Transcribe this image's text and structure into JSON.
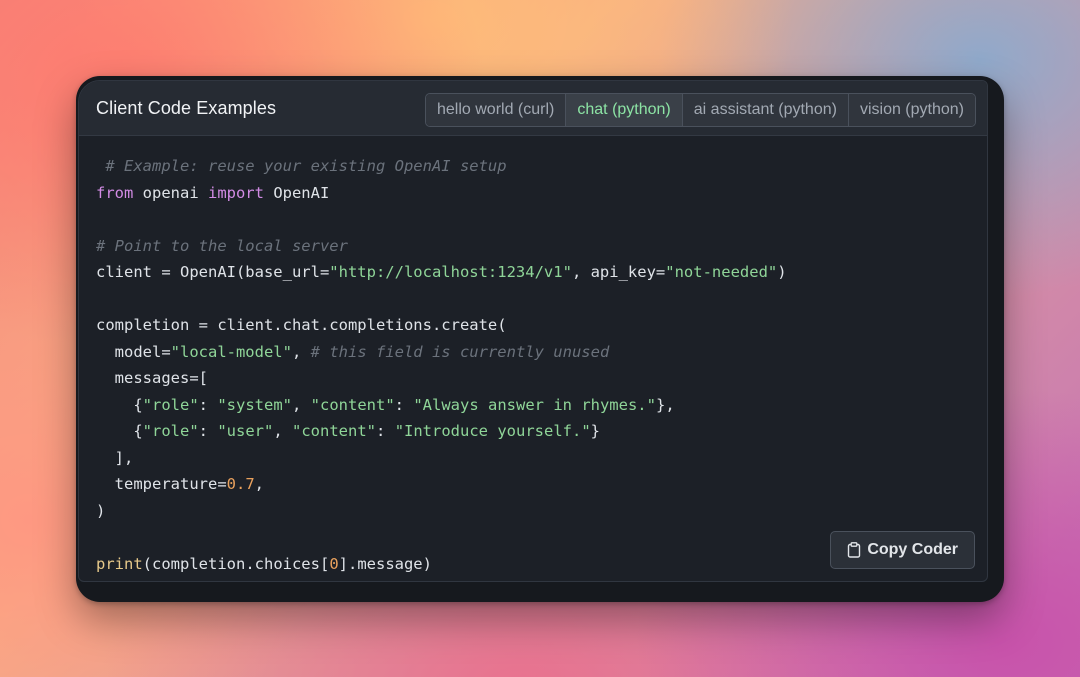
{
  "panel": {
    "title": "Client Code Examples"
  },
  "tabs": [
    {
      "label": "hello world (curl)",
      "active": false
    },
    {
      "label": "chat (python)",
      "active": true
    },
    {
      "label": "ai assistant (python)",
      "active": false
    },
    {
      "label": "vision (python)",
      "active": false
    }
  ],
  "code": {
    "language": "python",
    "lines": [
      [
        {
          "t": "c-comment",
          "v": " # Example: reuse your existing OpenAI setup"
        }
      ],
      [
        {
          "t": "c-kw",
          "v": "from"
        },
        {
          "t": "",
          "v": " openai "
        },
        {
          "t": "c-kw",
          "v": "import"
        },
        {
          "t": "",
          "v": " OpenAI"
        }
      ],
      [],
      [
        {
          "t": "c-comment",
          "v": "# Point to the local server"
        }
      ],
      [
        {
          "t": "",
          "v": "client = OpenAI(base_url="
        },
        {
          "t": "c-str",
          "v": "\"http://localhost:1234/v1\""
        },
        {
          "t": "",
          "v": ", api_key="
        },
        {
          "t": "c-str",
          "v": "\"not-needed\""
        },
        {
          "t": "",
          "v": ")"
        }
      ],
      [],
      [
        {
          "t": "",
          "v": "completion = client.chat.completions.create("
        }
      ],
      [
        {
          "t": "",
          "v": "  model="
        },
        {
          "t": "c-str",
          "v": "\"local-model\""
        },
        {
          "t": "",
          "v": ", "
        },
        {
          "t": "c-comment",
          "v": "# this field is currently unused"
        }
      ],
      [
        {
          "t": "",
          "v": "  messages=["
        }
      ],
      [
        {
          "t": "",
          "v": "    {"
        },
        {
          "t": "c-str",
          "v": "\"role\""
        },
        {
          "t": "",
          "v": ": "
        },
        {
          "t": "c-str",
          "v": "\"system\""
        },
        {
          "t": "",
          "v": ", "
        },
        {
          "t": "c-str",
          "v": "\"content\""
        },
        {
          "t": "",
          "v": ": "
        },
        {
          "t": "c-str",
          "v": "\"Always answer in rhymes.\""
        },
        {
          "t": "",
          "v": "},"
        }
      ],
      [
        {
          "t": "",
          "v": "    {"
        },
        {
          "t": "c-str",
          "v": "\"role\""
        },
        {
          "t": "",
          "v": ": "
        },
        {
          "t": "c-str",
          "v": "\"user\""
        },
        {
          "t": "",
          "v": ", "
        },
        {
          "t": "c-str",
          "v": "\"content\""
        },
        {
          "t": "",
          "v": ": "
        },
        {
          "t": "c-str",
          "v": "\"Introduce yourself.\""
        },
        {
          "t": "",
          "v": "}"
        }
      ],
      [
        {
          "t": "",
          "v": "  ],"
        }
      ],
      [
        {
          "t": "",
          "v": "  temperature="
        },
        {
          "t": "c-num",
          "v": "0.7"
        },
        {
          "t": "",
          "v": ","
        }
      ],
      [
        {
          "t": "",
          "v": ")"
        }
      ],
      [],
      [
        {
          "t": "c-fn",
          "v": "print"
        },
        {
          "t": "",
          "v": "(completion.choices["
        },
        {
          "t": "c-num",
          "v": "0"
        },
        {
          "t": "",
          "v": "].message)"
        }
      ]
    ]
  },
  "copy_button": {
    "label": "Copy Coder",
    "icon": "clipboard-icon"
  },
  "colors": {
    "accent_green": "#8ce3a4",
    "comment": "#6b727c",
    "keyword": "#d28be4",
    "string": "#8fd598",
    "number": "#e9a15d",
    "function": "#e7c98a"
  }
}
